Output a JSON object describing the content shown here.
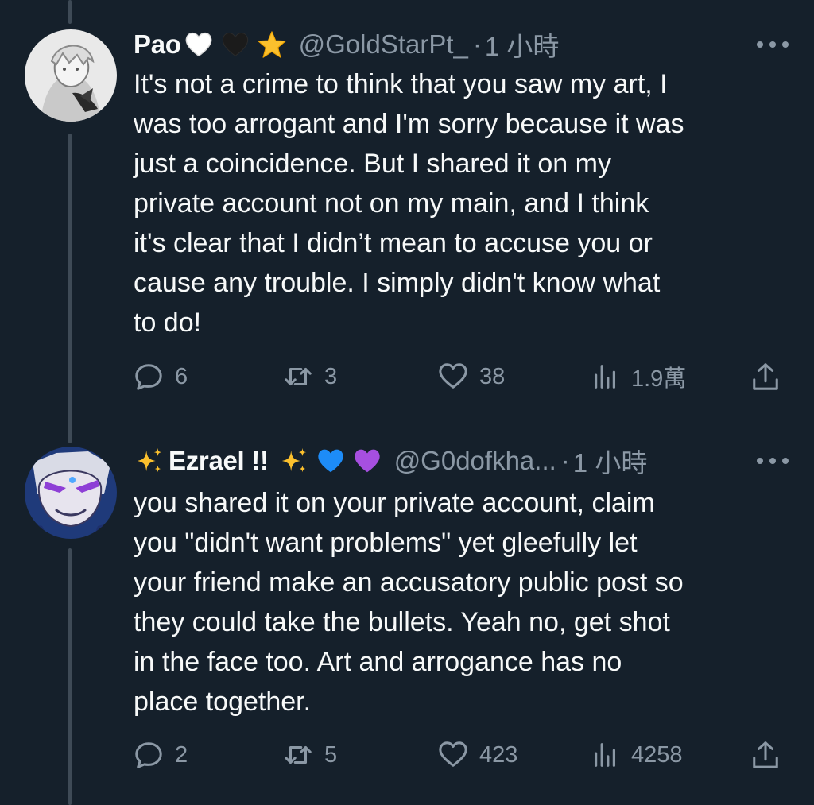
{
  "tweets": [
    {
      "display_name": "Pao",
      "name_emojis": [
        "white-heart-emoji",
        "black-heart-emoji",
        "star-emoji"
      ],
      "handle": "@GoldStarPt_",
      "separator": "·",
      "time": "1 小時",
      "text": "It's not a crime to think that you saw my art, I was too arrogant and I'm sorry because it was just a coincidence. But I shared it on my private account not on my main, and I think it's clear that I didn’t mean to accuse you or cause any trouble. I simply didn't know what to do!",
      "lines": [
        "It's not a crime to think that you saw my art, I",
        "was too arrogant and I'm sorry because it was",
        "just a coincidence. But I shared it on my",
        "private account not on my main, and I think",
        "it's clear that I didn’t mean to accuse you or",
        "cause any trouble. I simply didn't know what",
        "to do!"
      ],
      "replies": "6",
      "reposts": "3",
      "likes": "38",
      "views": "1.9萬"
    },
    {
      "display_name": "Ezrael !!",
      "name_prefix_emoji": "sparkles-emoji",
      "name_emojis": [
        "sparkles-emoji",
        "blue-heart-emoji",
        "purple-heart-emoji"
      ],
      "handle": "@G0dofkha...",
      "separator": "·",
      "time": "1 小時",
      "text": "you shared it on your private account, claim you \"didn't want problems\" yet gleefully let your friend make an accusatory public post so they could take the bullets. Yeah no, get shot in the face too. Art and arrogance has no place together.",
      "lines": [
        "you shared it on your private account, claim",
        "you \"didn't want problems\" yet gleefully let",
        "your friend make an accusatory public post so",
        "they could take the bullets. Yeah no, get shot",
        "in the face too. Art and arrogance has no",
        "place together."
      ],
      "replies": "2",
      "reposts": "5",
      "likes": "423",
      "views": "4258"
    }
  ],
  "icons": {
    "reply": "reply-icon",
    "repost": "repost-icon",
    "like": "heart-icon",
    "views": "views-icon",
    "share": "share-icon",
    "more": "more-icon"
  },
  "colors": {
    "background": "#15202b",
    "text": "#f7f9f9",
    "secondary": "#8b98a5",
    "thread_line": "#3e4a56"
  }
}
